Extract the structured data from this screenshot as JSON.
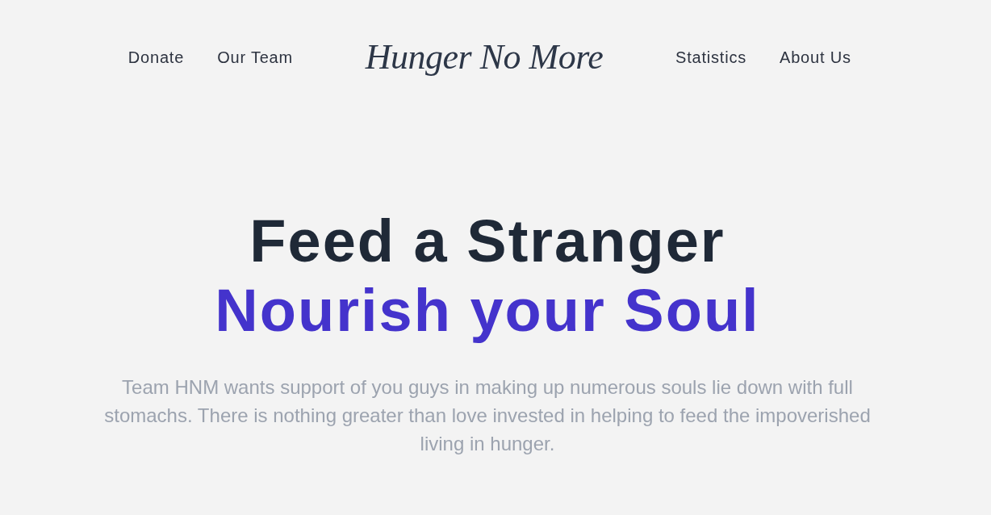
{
  "nav": {
    "left_links": [
      {
        "label": "Donate"
      },
      {
        "label": "Our Team"
      }
    ],
    "logo": "Hunger No More",
    "right_links": [
      {
        "label": "Statistics"
      },
      {
        "label": "About Us"
      }
    ]
  },
  "hero": {
    "headline_lines": [
      {
        "text": "Feed a Stranger",
        "kind": "dark"
      },
      {
        "text": "Nourish your Soul",
        "kind": "accent"
      }
    ],
    "description": "Team HNM wants support of you guys in making up numerous souls lie down with full stomachs. There is nothing greater than love invested in helping to feed the impoverished living in hunger."
  }
}
